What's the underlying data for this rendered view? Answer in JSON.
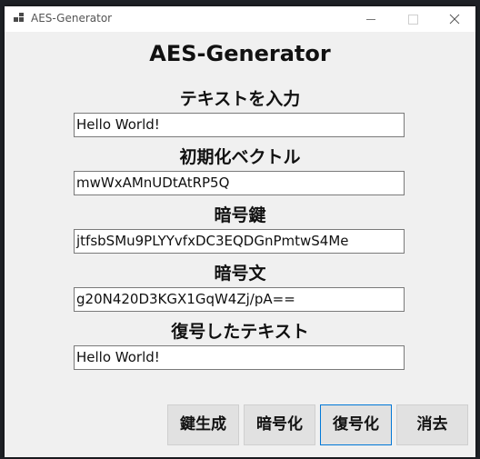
{
  "window": {
    "title": "AES-Generator"
  },
  "form": {
    "title": "AES-Generator",
    "plaintext_label": "テキストを入力",
    "plaintext_value": "Hello World!",
    "iv_label": "初期化ベクトル",
    "iv_value": "mwWxAMnUDtAtRP5Q",
    "key_label": "暗号鍵",
    "key_value": "jtfsbSMu9PLYYvfxDC3EQDGnPmtwS4Me",
    "ciphertext_label": "暗号文",
    "ciphertext_value": "g20N420D3KGX1GqW4Zj/pA==",
    "decrypted_label": "復号したテキスト",
    "decrypted_value": "Hello World!"
  },
  "buttons": {
    "generate_key": "鍵生成",
    "encrypt": "暗号化",
    "decrypt": "復号化",
    "clear": "消去"
  },
  "icons": {
    "app": "app-icon",
    "minimize": "minimize-icon",
    "maximize": "maximize-icon",
    "close": "close-icon"
  },
  "colors": {
    "window_bg": "#f0f0f0",
    "focus_border": "#0078d7",
    "button_bg": "#e1e1e1"
  }
}
